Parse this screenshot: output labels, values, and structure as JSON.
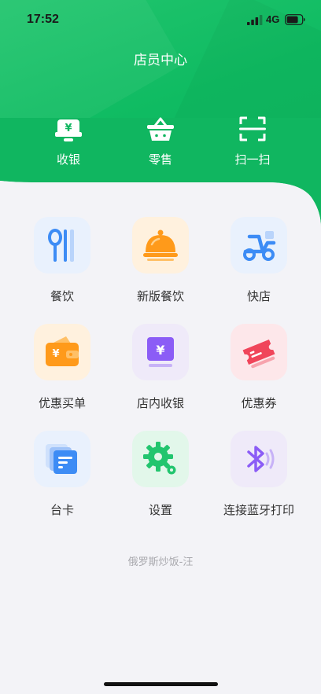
{
  "status_bar": {
    "time": "17:52",
    "network": "4G"
  },
  "header": {
    "title": "店员中心"
  },
  "quick_actions": [
    {
      "label": "收银",
      "icon": "cashier-icon"
    },
    {
      "label": "零售",
      "icon": "basket-icon"
    },
    {
      "label": "扫一扫",
      "icon": "scan-icon"
    }
  ],
  "grid": [
    {
      "label": "餐饮",
      "icon": "fork-knife-icon"
    },
    {
      "label": "新版餐饮",
      "icon": "food-cloche-icon"
    },
    {
      "label": "快店",
      "icon": "scooter-icon"
    },
    {
      "label": "优惠买单",
      "icon": "wallet-icon"
    },
    {
      "label": "店内收银",
      "icon": "cash-register-icon"
    },
    {
      "label": "优惠券",
      "icon": "coupon-icon"
    },
    {
      "label": "台卡",
      "icon": "cards-icon"
    },
    {
      "label": "设置",
      "icon": "gear-icon"
    },
    {
      "label": "连接蓝牙打印",
      "icon": "bluetooth-icon"
    }
  ],
  "footer": {
    "store_name": "俄罗斯炒饭-汪"
  },
  "colors": {
    "header_green": "#10b660",
    "background": "#f3f3f7",
    "orange": "#ff9a1a",
    "blue": "#3d8cf5",
    "purple": "#8b5cf6",
    "red": "#f0455a",
    "green": "#22c56e"
  }
}
